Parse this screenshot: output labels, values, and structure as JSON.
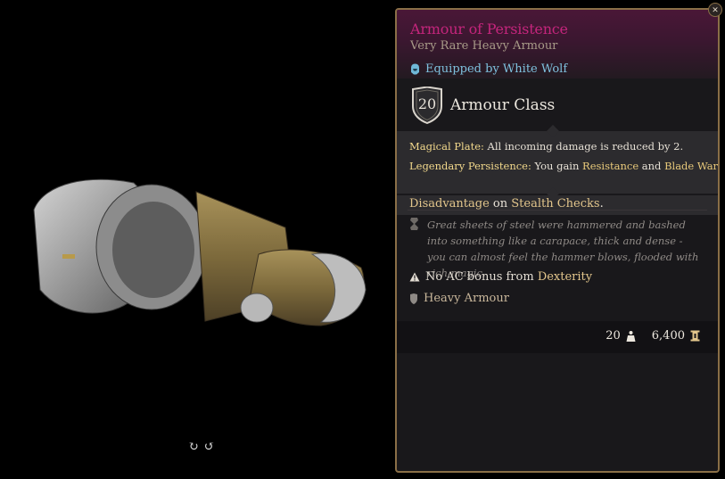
{
  "item": {
    "name": "Armour of Persistence",
    "type": "Very Rare Heavy Armour",
    "equipped": "Equipped by White Wolf"
  },
  "armour_class": {
    "value": "20",
    "label": "Armour Class"
  },
  "properties": {
    "magical_plate_key": "Magical Plate:",
    "magical_plate_text": " All incoming damage is reduced by 2.",
    "legendary_key": "Legendary Persistence:",
    "legendary_text_1": " You gain ",
    "legendary_hl_1": "Resistance",
    "legendary_text_2": " and ",
    "legendary_hl_2": "Blade Ward",
    "legendary_text_3": ".",
    "disadvantage_hl": "Disadvantage",
    "disadvantage_mid": " on ",
    "disadvantage_hl_2": "Stealth Checks",
    "disadvantage_end": "."
  },
  "lore": "Great sheets of steel were hammered and bashed into something like a carapace, thick and dense - you can almost feel the hammer blows, flooded with rich magic.",
  "notes": {
    "no_ac_text": "No AC bonus from ",
    "no_ac_hl": "Dexterity",
    "heavy_armour": "Heavy Armour"
  },
  "footer": {
    "weight": "20",
    "value": "6,400"
  },
  "controls": {
    "rotate_left": "↻",
    "rotate_right": "↺",
    "close": "✕"
  },
  "colors": {
    "rarity": "#c4257c",
    "equipped": "#7fc2df",
    "highlight": "#e3c68c",
    "border": "#8a6f47"
  },
  "icons": {
    "equipped": "equipped-helmet-icon",
    "ac": "shield-icon",
    "lore": "scroll-icon",
    "warning": "warning-icon",
    "armour": "shield-armour-icon",
    "weight": "weight-icon",
    "gold": "gold-icon"
  }
}
